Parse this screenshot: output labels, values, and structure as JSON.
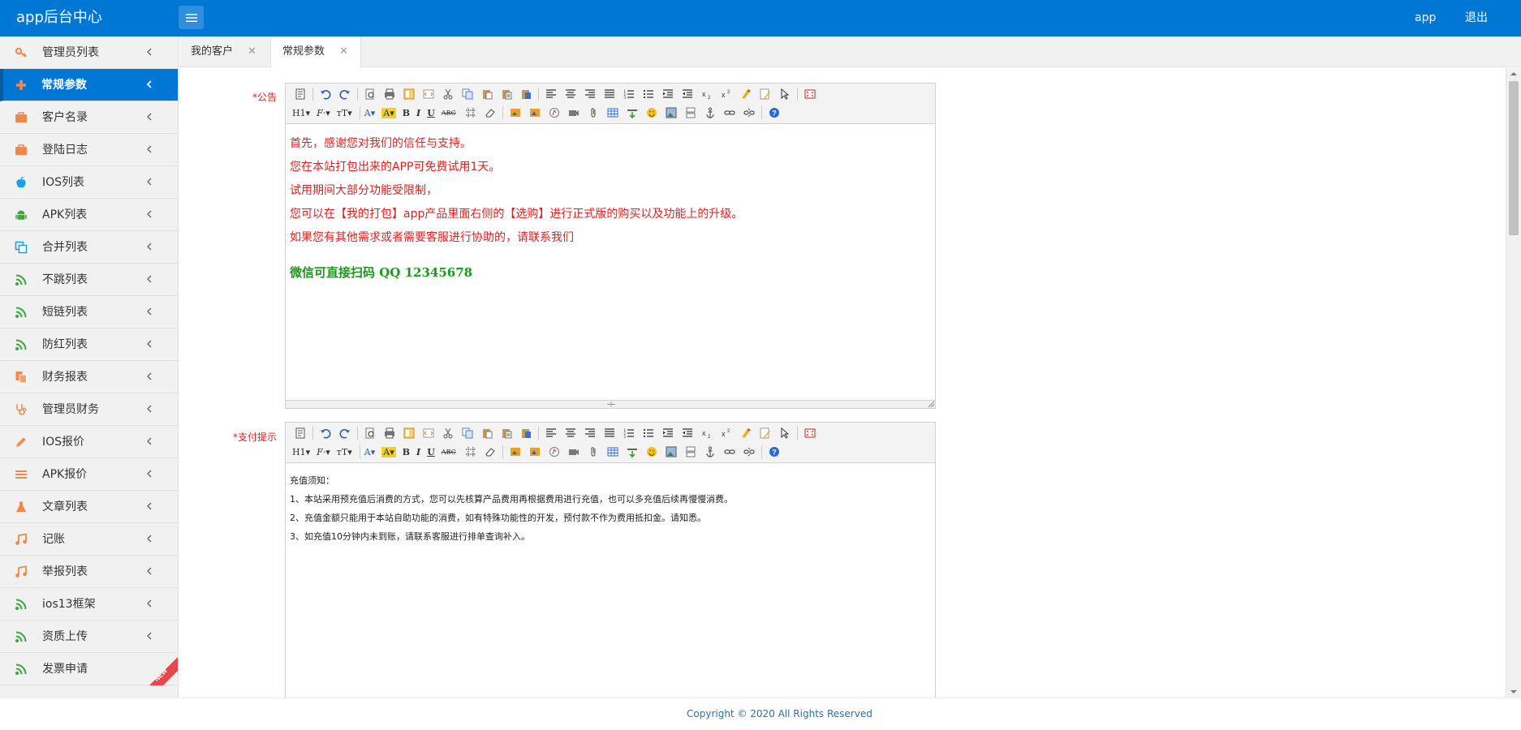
{
  "header": {
    "logo": "app后台中心",
    "user_label": "app",
    "logout_label": "退出"
  },
  "sidebar": {
    "items": [
      {
        "label": "管理员列表",
        "icon": "key-icon",
        "color": "#f0884a"
      },
      {
        "label": "常规参数",
        "icon": "plus-icon",
        "color": "#f0884a",
        "active": true
      },
      {
        "label": "客户名录",
        "icon": "briefcase-icon",
        "color": "#f0884a"
      },
      {
        "label": "登陆日志",
        "icon": "briefcase-icon",
        "color": "#f0884a"
      },
      {
        "label": "IOS列表",
        "icon": "apple-icon",
        "color": "#1aa0e8"
      },
      {
        "label": "APK列表",
        "icon": "android-icon",
        "color": "#3da63d"
      },
      {
        "label": "合并列表",
        "icon": "copy-icon",
        "color": "#1aa0e8"
      },
      {
        "label": "不跳列表",
        "icon": "rss-icon",
        "color": "#3da63d"
      },
      {
        "label": "短链列表",
        "icon": "rss-icon",
        "color": "#3da63d"
      },
      {
        "label": "防红列表",
        "icon": "rss-icon",
        "color": "#3da63d"
      },
      {
        "label": "财务报表",
        "icon": "files-icon",
        "color": "#f0884a"
      },
      {
        "label": "管理员财务",
        "icon": "stethoscope-icon",
        "color": "#f0884a"
      },
      {
        "label": "IOS报价",
        "icon": "pencil-icon",
        "color": "#f0884a"
      },
      {
        "label": "APK报价",
        "icon": "list-icon",
        "color": "#f0884a"
      },
      {
        "label": "文章列表",
        "icon": "flask-icon",
        "color": "#f0884a"
      },
      {
        "label": "记账",
        "icon": "music-icon",
        "color": "#f0884a"
      },
      {
        "label": "举报列表",
        "icon": "music-icon",
        "color": "#f0884a"
      },
      {
        "label": "ios13框架",
        "icon": "rss-icon",
        "color": "#3da63d"
      },
      {
        "label": "资质上传",
        "icon": "rss-icon",
        "color": "#3da63d"
      },
      {
        "label": "发票申请",
        "icon": "rss-icon",
        "color": "#3da63d",
        "badge": "NEW"
      }
    ]
  },
  "tabs": [
    {
      "label": "我的客户"
    },
    {
      "label": "常规参数",
      "active": true
    }
  ],
  "form": {
    "notice_label": "*公告",
    "notice_lines": [
      "首先，感谢您对我们的信任与支持。",
      "您在本站打包出来的APP可免费试用1天。",
      "试用期间大部分功能受限制，",
      "您可以在【我的打包】app产品里面右侧的【选购】进行正式版的购买以及功能上的升级。",
      "如果您有其他需求或者需要客服进行协助的，请联系我们"
    ],
    "notice_contact": "微信可直接扫码  QQ 12345678",
    "pay_label": "*支付提示",
    "pay_lines": [
      "充值须知：",
      "1、本站采用预充值后消费的方式，您可以先核算产品费用再根据费用进行充值，也可以多充值后续再慢慢消费。",
      "2、充值金额只能用于本站自助功能的消费，如有特殊功能性的开发，预付款不作为费用抵扣金。请知悉。",
      "3、如充值10分钟内未到账，请联系客服进行排单查询补入。"
    ]
  },
  "toolbar": {
    "heading_label": "H1",
    "font_label": "F",
    "size_label": "T",
    "color_label": "A",
    "bold_label": "B",
    "italic_label": "I",
    "underline_label": "U",
    "strike_label": "ABC"
  },
  "footer": {
    "copyright": "Copyright © 2020 All Rights Reserved"
  },
  "colors": {
    "header_bg": "#0077d4",
    "required_red": "#e02020",
    "contact_green": "#1a9a1a"
  }
}
